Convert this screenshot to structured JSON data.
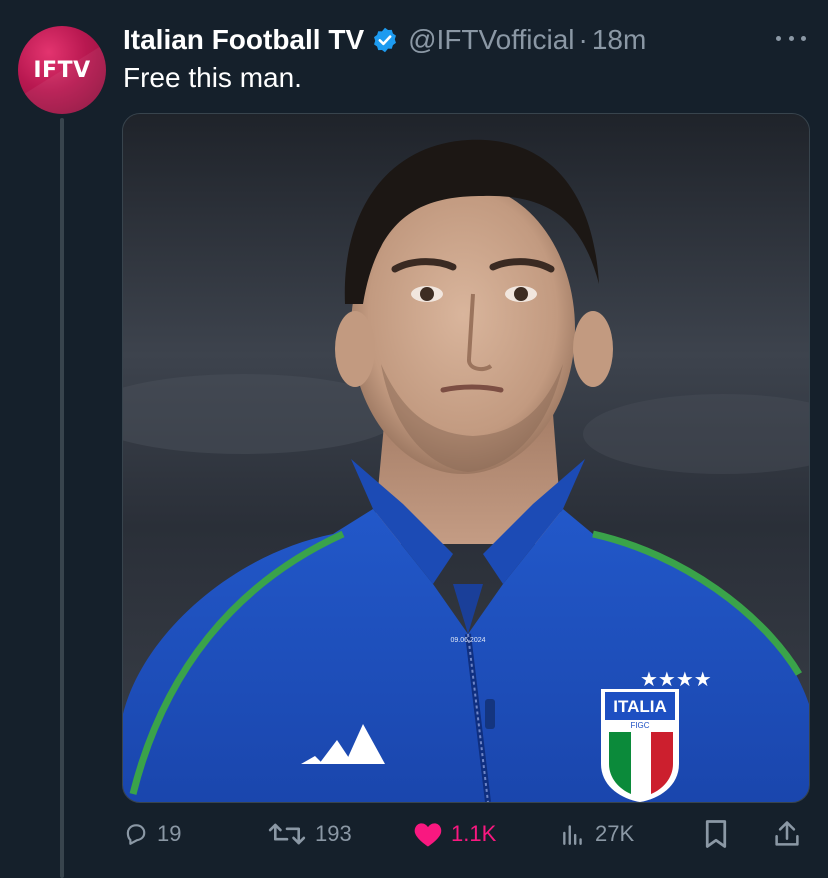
{
  "tweet": {
    "avatar_text": "IFTV",
    "display_name": "Italian Football TV",
    "verified_icon": "verified-badge-icon",
    "handle": "@IFTVofficial",
    "separator": "·",
    "time": "18m",
    "text": "Free this man."
  },
  "media": {
    "description_icon": "player-photo",
    "crest_text": "ITALIA",
    "crest_subtext": "FIGC",
    "shirt_date": "09.06.2024"
  },
  "actions": {
    "reply": {
      "icon": "reply-icon",
      "count": "19"
    },
    "retweet": {
      "icon": "retweet-icon",
      "count": "193"
    },
    "like": {
      "icon": "heart-icon",
      "count": "1.1K",
      "active": true,
      "color": "#f91880"
    },
    "views": {
      "icon": "views-icon",
      "count": "27K"
    },
    "bookmark": {
      "icon": "bookmark-icon"
    },
    "share": {
      "icon": "share-icon"
    }
  },
  "colors": {
    "background": "#15202b",
    "secondary_text": "#8b98a5",
    "verified": "#1d9bf0",
    "like": "#f91880"
  }
}
